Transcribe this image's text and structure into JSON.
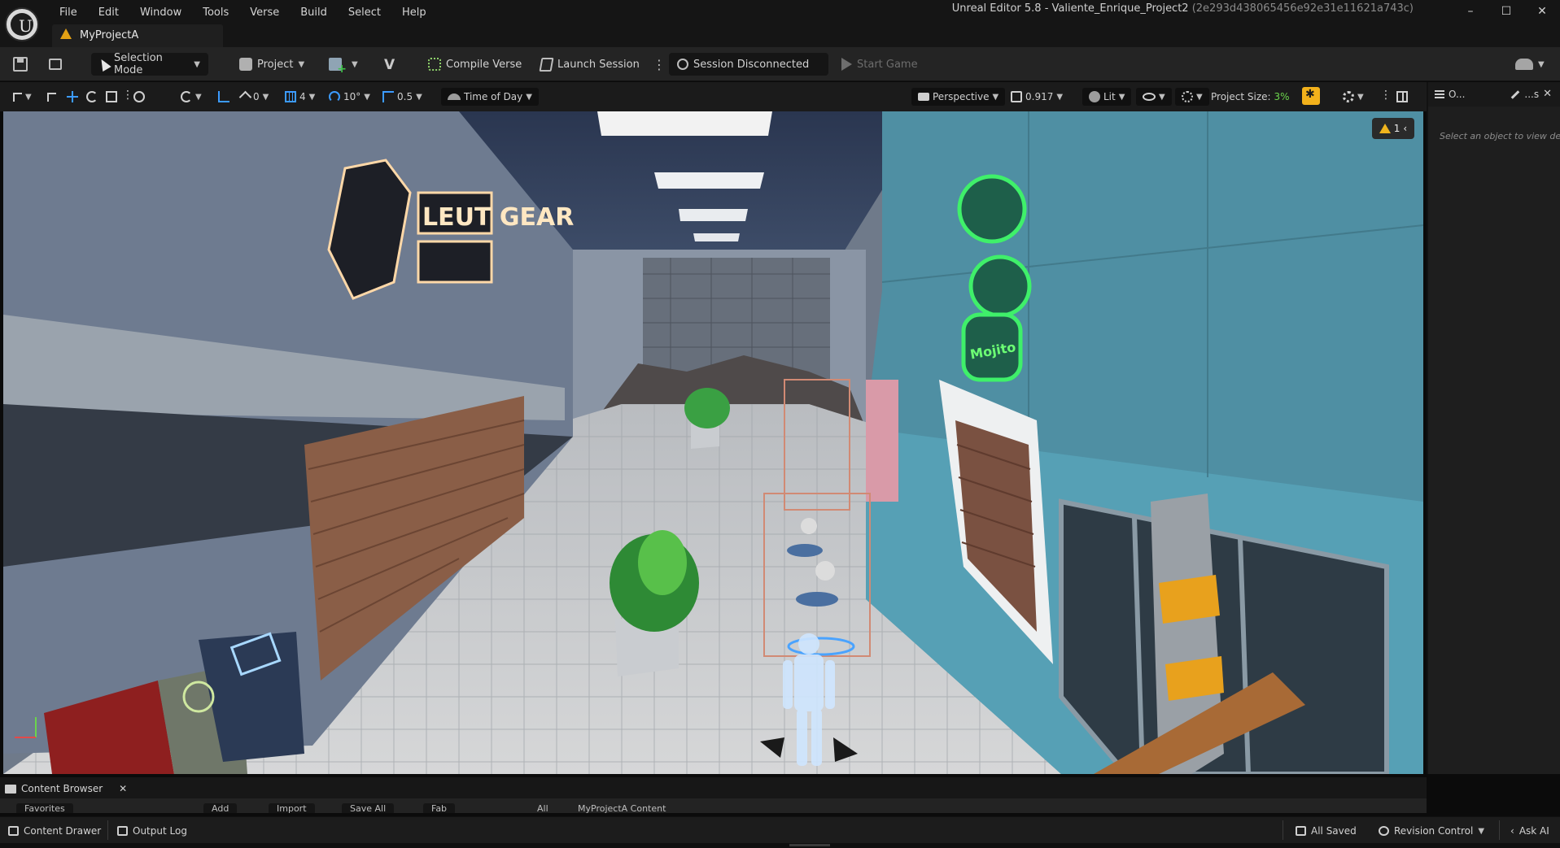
{
  "menu": [
    "File",
    "Edit",
    "Window",
    "Tools",
    "Verse",
    "Build",
    "Select",
    "Help"
  ],
  "window": {
    "title": "Unreal Editor 5.8 - Valiente_Enrique_Project2",
    "hash": "(2e293d438065456e92e31e11621a743c)",
    "minimize": "–",
    "maximize": "☐",
    "close": "✕"
  },
  "project_tab": {
    "label": "MyProjectA"
  },
  "toolbar": {
    "selection_mode": "Selection Mode",
    "project": "Project",
    "compile_verse": "Compile Verse",
    "launch_session": "Launch Session",
    "session_status": "Session Disconnected",
    "start_game": "Start Game"
  },
  "viewport_toolbar": {
    "snap_location": "0",
    "grid_size": "4",
    "rotation_snap": "10°",
    "scale_snap": "0.5",
    "time_of_day": "Time of Day",
    "perspective": "Perspective",
    "camera_speed": "0.917",
    "view_mode": "Lit",
    "project_size_label": "Project Size:",
    "project_size_value": "3%"
  },
  "viewport": {
    "warning_count": "1",
    "sign_left": "LEUT GEAR",
    "sign_right": "Mojito"
  },
  "side_panel": {
    "tab_outliner": "O...",
    "tab_details": "...s",
    "close": "✕",
    "hint": "Select an object to view det"
  },
  "content_browser": {
    "tab": "Content Browser",
    "close": "✕",
    "sliver": [
      "Favorites",
      "Add",
      "Import",
      "Save All",
      "Fab",
      "All",
      "MyProjectA Content"
    ]
  },
  "statusbar": {
    "content_drawer": "Content Drawer",
    "output_log": "Output Log",
    "all_saved": "All Saved",
    "revision_control": "Revision Control",
    "ask_ai": "Ask AI"
  },
  "colors": {
    "accent_blue": "#3c9bff",
    "warning_yellow": "#f0b41d",
    "project_size_green": "#6bd44c"
  }
}
